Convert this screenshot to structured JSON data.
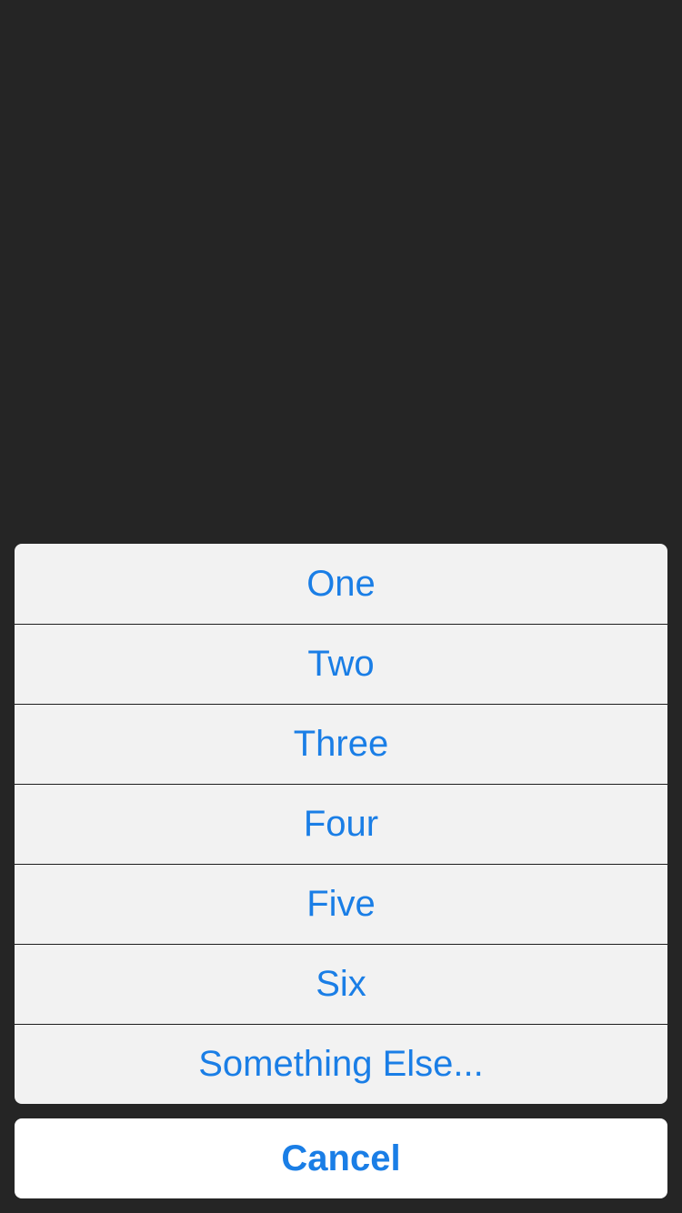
{
  "colors": {
    "background": "#252525",
    "sheet_background": "#f2f2f2",
    "cancel_background": "#ffffff",
    "accent": "#1a7ee6",
    "separator": "#1e1e1e"
  },
  "action_sheet": {
    "items": [
      {
        "label": "One"
      },
      {
        "label": "Two"
      },
      {
        "label": "Three"
      },
      {
        "label": "Four"
      },
      {
        "label": "Five"
      },
      {
        "label": "Six"
      },
      {
        "label": "Something Else..."
      }
    ],
    "cancel_label": "Cancel"
  }
}
